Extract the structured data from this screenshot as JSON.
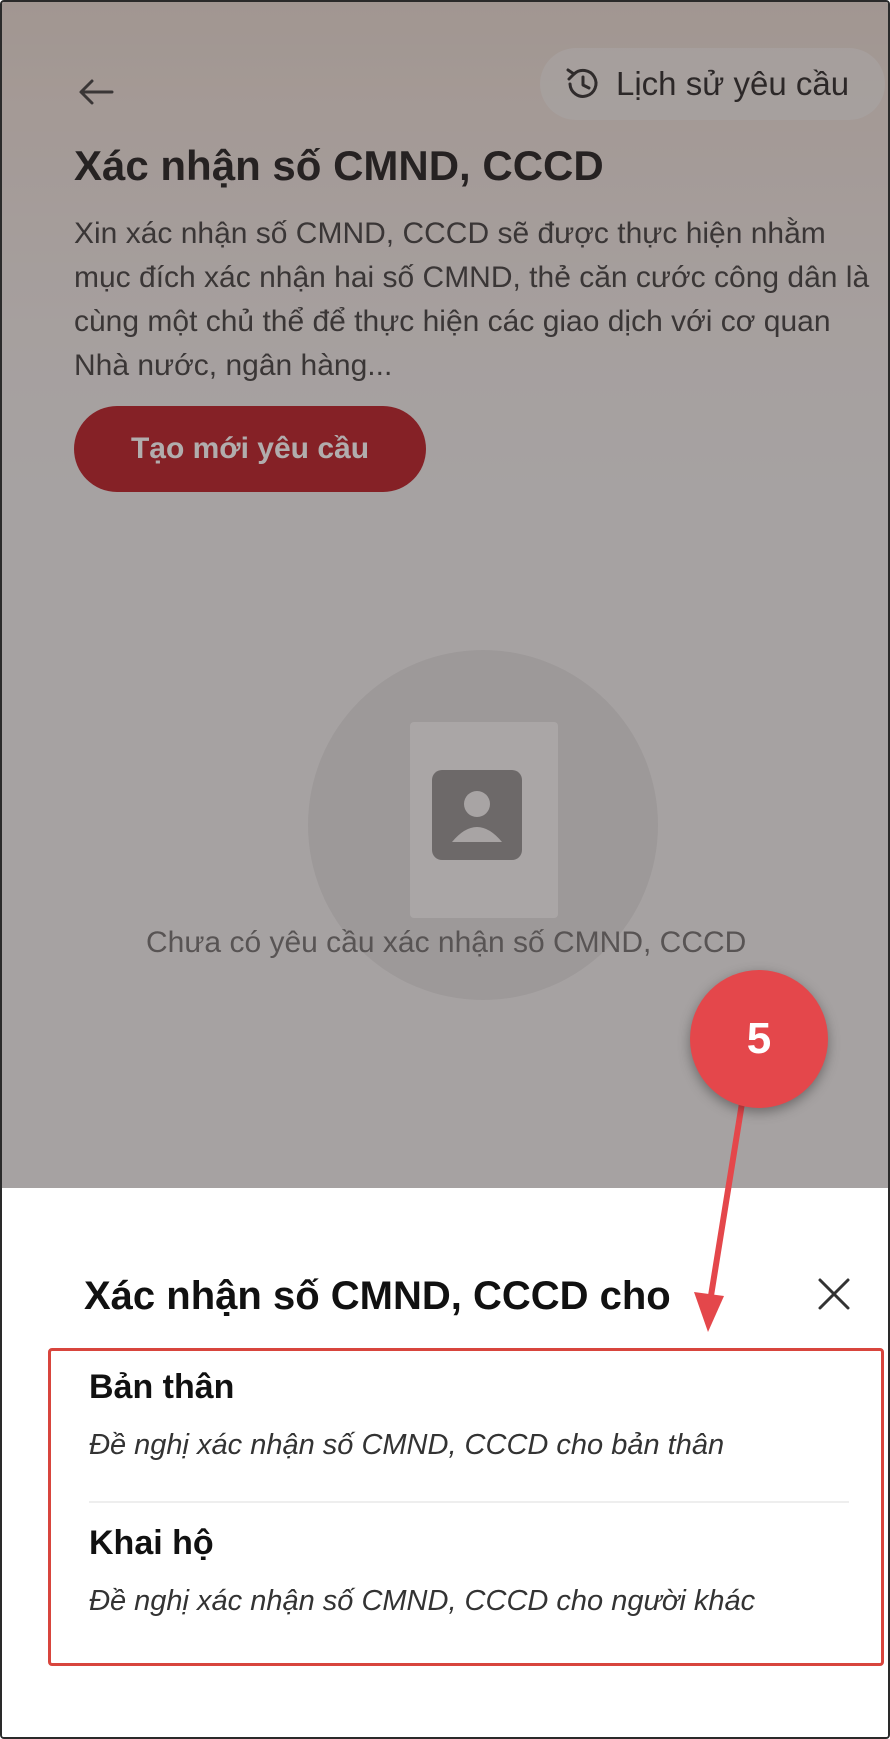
{
  "header": {
    "back_icon": "back-arrow-icon",
    "history_icon": "history-clock-icon",
    "history_label": "Lịch sử yêu cầu"
  },
  "main": {
    "title": "Xác nhận số CMND, CCCD",
    "description": "Xin xác nhận số CMND, CCCD sẽ được thực hiện nhằm mục đích xác nhận hai số CMND, thẻ căn cước công dân là cùng một chủ thể để thực hiện các giao dịch với cơ quan Nhà nước, ngân hàng...",
    "create_button_label": "Tạo mới yêu cầu",
    "empty_state_text": "Chưa có yêu cầu xác nhận số CMND, CCCD"
  },
  "sheet": {
    "title": "Xác nhận số CMND, CCCD cho",
    "close_icon": "close-icon",
    "options": [
      {
        "title": "Bản thân",
        "subtitle": "Đề nghị xác nhận số CMND, CCCD cho bản thân"
      },
      {
        "title": "Khai hộ",
        "subtitle": "Đề nghị xác nhận số CMND, CCCD cho người khác"
      }
    ]
  },
  "annotation": {
    "step_number": "5"
  },
  "colors": {
    "brand_red": "#b30e18",
    "highlight_red": "#d8453d",
    "badge_red": "#e4474b"
  }
}
